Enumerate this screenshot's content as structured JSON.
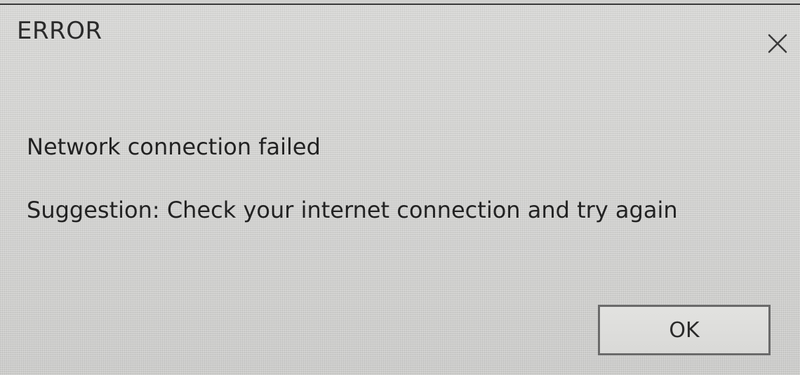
{
  "dialog": {
    "title": "ERROR",
    "close_icon": "close-icon",
    "message": "Network connection failed",
    "suggestion": "Suggestion: Check your internet connection and try again",
    "ok_label": "OK"
  }
}
